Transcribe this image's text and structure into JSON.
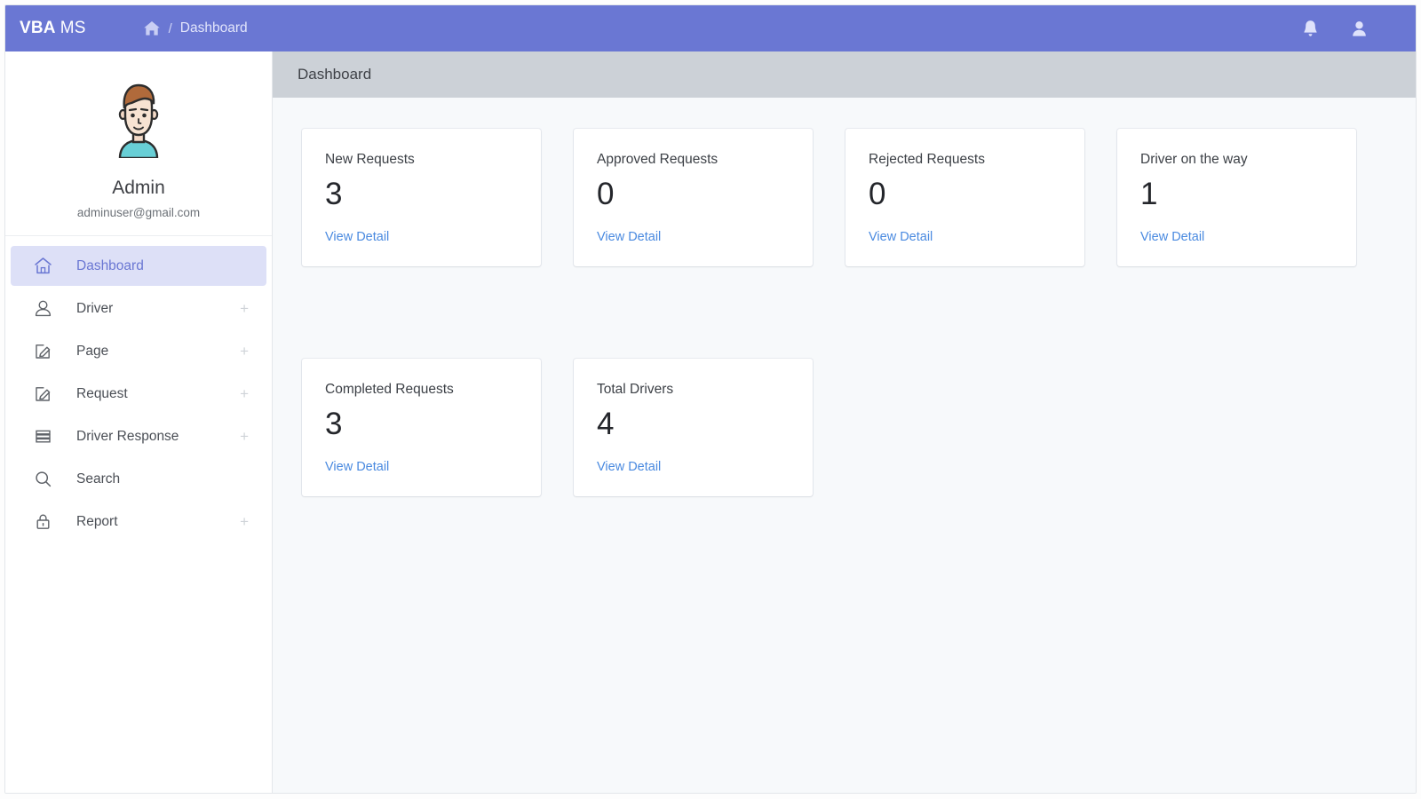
{
  "navbar": {
    "brand_primary": "VBA",
    "brand_secondary": "MS",
    "home_icon": "home-icon",
    "breadcrumb_separator": "/",
    "breadcrumb_current": "Dashboard",
    "notification_icon": "bell-icon",
    "account_icon": "user-icon",
    "background_color": "#6a77d3"
  },
  "sidebar": {
    "avatar_icon": "user-avatar",
    "user_name": "Admin",
    "user_email": "adminuser@gmail.com",
    "expand_symbol": "+",
    "active_color": "#6a77d3",
    "active_background": "#dde0f7",
    "items": [
      {
        "label": "Dashboard",
        "icon": "home-icon",
        "expandable": false,
        "active": true
      },
      {
        "label": "Driver",
        "icon": "user-outline-icon",
        "expandable": true,
        "active": false
      },
      {
        "label": "Page",
        "icon": "edit-square-icon",
        "expandable": true,
        "active": false
      },
      {
        "label": "Request",
        "icon": "edit-square-icon",
        "expandable": true,
        "active": false
      },
      {
        "label": "Driver Response",
        "icon": "layers-icon",
        "expandable": true,
        "active": false
      },
      {
        "label": "Search",
        "icon": "search-icon",
        "expandable": false,
        "active": false
      },
      {
        "label": "Report",
        "icon": "lock-icon",
        "expandable": true,
        "active": false
      }
    ]
  },
  "main": {
    "page_title": "Dashboard",
    "title_bar_color": "#ccd1d7",
    "background_color": "#f7f9fb",
    "link_color": "#4a8ae0",
    "cards": [
      {
        "title": "New Requests",
        "value": "3",
        "link": "View Detail"
      },
      {
        "title": "Approved Requests",
        "value": "0",
        "link": "View Detail"
      },
      {
        "title": "Rejected Requests",
        "value": "0",
        "link": "View Detail"
      },
      {
        "title": "Driver on the way",
        "value": "1",
        "link": "View Detail"
      },
      {
        "title": "Completed Requests",
        "value": "3",
        "link": "View Detail"
      },
      {
        "title": "Total Drivers",
        "value": "4",
        "link": "View Detail"
      }
    ]
  }
}
